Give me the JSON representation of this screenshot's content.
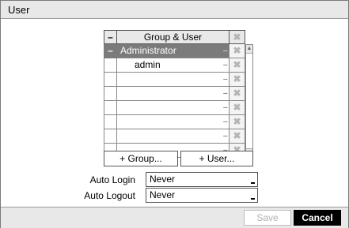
{
  "window": {
    "title": "User"
  },
  "grid": {
    "header": {
      "collapse": "–",
      "title": "Group & User",
      "delete": "✖"
    },
    "rows": [
      {
        "collapse": "–",
        "name": "Administrator",
        "ellipsis": "...",
        "delete": "✖"
      },
      {
        "collapse": "",
        "name": "admin",
        "ellipsis": "...",
        "delete": "✖"
      },
      {
        "collapse": "",
        "name": "",
        "ellipsis": "...",
        "delete": "✖"
      },
      {
        "collapse": "",
        "name": "",
        "ellipsis": "...",
        "delete": "✖"
      },
      {
        "collapse": "",
        "name": "",
        "ellipsis": "...",
        "delete": "✖"
      },
      {
        "collapse": "",
        "name": "",
        "ellipsis": "...",
        "delete": "✖"
      },
      {
        "collapse": "",
        "name": "",
        "ellipsis": "...",
        "delete": "✖"
      },
      {
        "collapse": "",
        "name": "",
        "ellipsis": "...",
        "delete": "✖"
      }
    ]
  },
  "actions": {
    "add_group": "+ Group...",
    "add_user": "+ User..."
  },
  "settings": {
    "auto_login": {
      "label": "Auto Login",
      "value": "Never"
    },
    "auto_logout": {
      "label": "Auto Logout",
      "value": "Never"
    }
  },
  "footer": {
    "save": "Save",
    "cancel": "Cancel"
  }
}
